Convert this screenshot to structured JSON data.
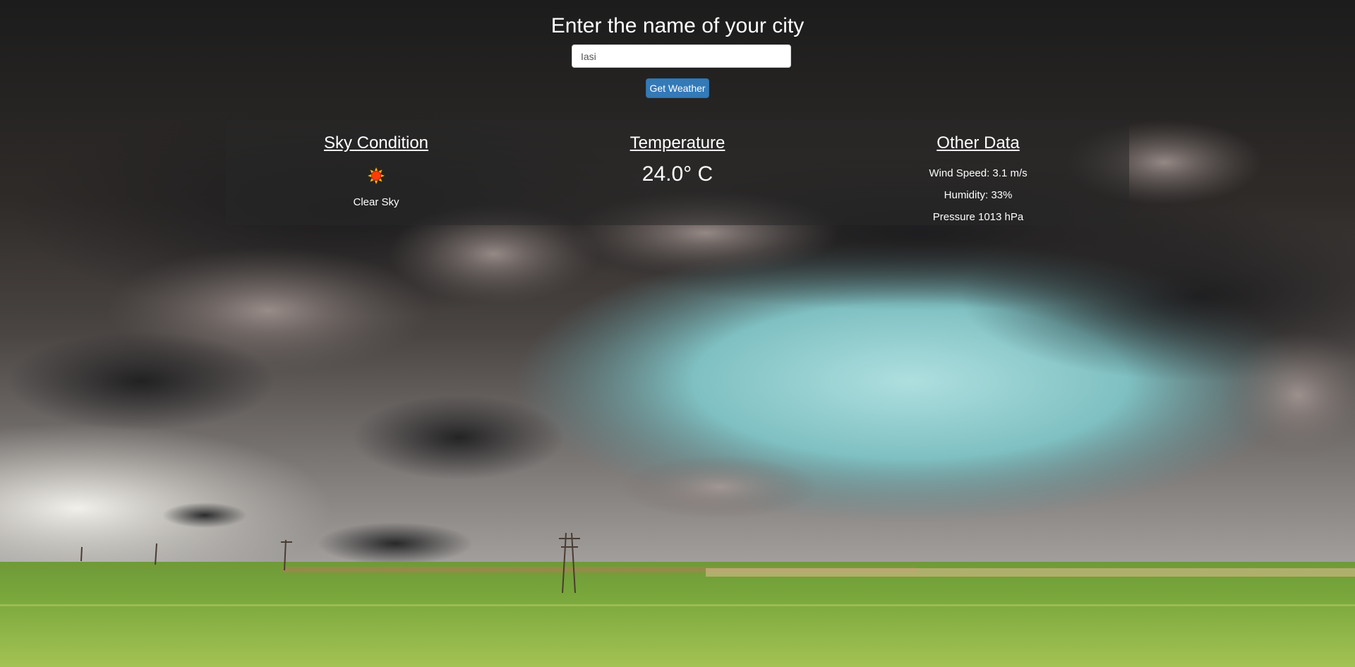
{
  "header": {
    "title": "Enter the name of your city"
  },
  "search": {
    "value": "Iasi",
    "button_label": "Get Weather"
  },
  "sky": {
    "heading": "Sky Condition",
    "icon": "sun-icon",
    "description": "Clear Sky"
  },
  "temperature": {
    "heading": "Temperature",
    "value": "24.0° C"
  },
  "other": {
    "heading": "Other Data",
    "wind": "Wind Speed: 3.1 m/s",
    "humidity": "Humidity: 33%",
    "pressure": "Pressure 1013 hPa"
  },
  "colors": {
    "button": "#337ab7",
    "text": "#ffffff",
    "sun": "#ff3d00"
  }
}
